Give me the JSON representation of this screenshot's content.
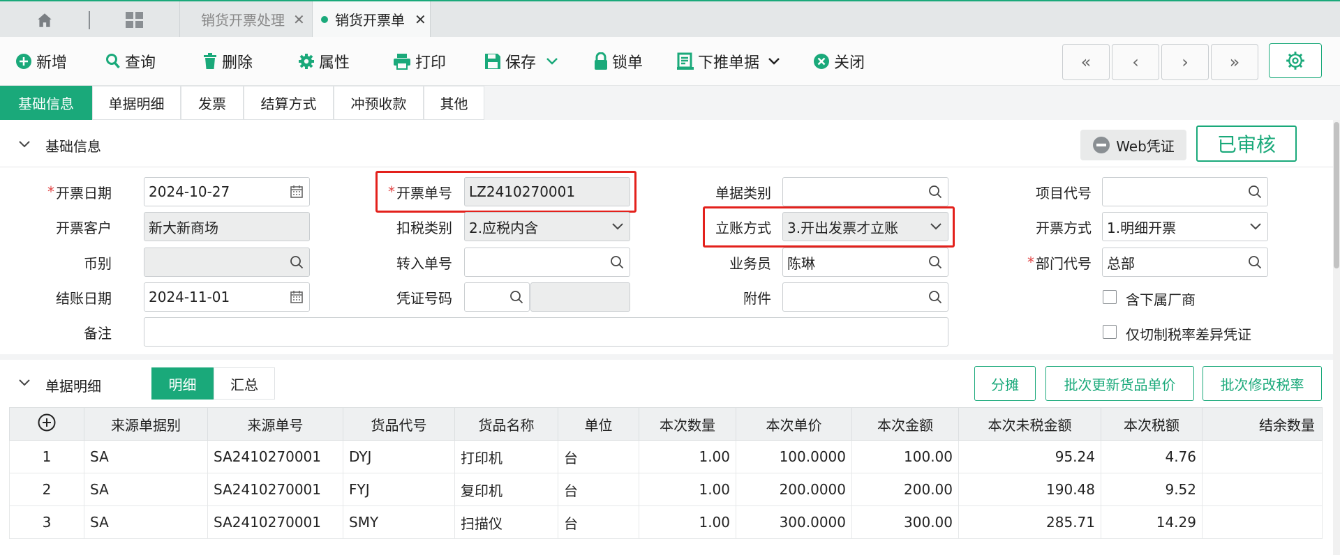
{
  "tabs": {
    "list_tab": "销货开票处理",
    "active_tab": "销货开票单"
  },
  "toolbar": {
    "new": "新增",
    "query": "查询",
    "delete": "删除",
    "properties": "属性",
    "print": "打印",
    "save": "保存",
    "lock": "锁单",
    "push_down": "下推单据",
    "close": "关闭"
  },
  "nav": {
    "first": "«",
    "prev": "‹",
    "next": "›",
    "last": "»"
  },
  "section_tabs": [
    "基础信息",
    "单据明细",
    "发票",
    "结算方式",
    "冲预收款",
    "其他"
  ],
  "basic": {
    "title": "基础信息",
    "web_voucher": "Web凭证",
    "status": "已审核"
  },
  "form": {
    "invoice_date_label": "开票日期",
    "invoice_date": "2024-10-27",
    "invoice_no_label": "开票单号",
    "invoice_no": "LZ2410270001",
    "doc_type_label": "单据类别",
    "doc_type": "",
    "project_code_label": "项目代号",
    "project_code": "",
    "customer_label": "开票客户",
    "customer": "新大新商场",
    "tax_type_label": "扣税类别",
    "tax_type": "2.应税内含",
    "account_method_label": "立账方式",
    "account_method": "3.开出发票才立账",
    "invoice_method_label": "开票方式",
    "invoice_method": "1.明细开票",
    "currency_label": "币别",
    "currency": "",
    "transfer_no_label": "转入单号",
    "transfer_no": "",
    "salesman_label": "业务员",
    "salesman": "陈琳",
    "dept_code_label": "部门代号",
    "dept_code": "总部",
    "close_date_label": "结账日期",
    "close_date": "2024-11-01",
    "voucher_no_label": "凭证号码",
    "attachment_label": "附件",
    "include_sub_label": "含下属厂商",
    "tax_diff_label": "仅切制税率差异凭证",
    "remark_label": "备注",
    "remark": ""
  },
  "detail": {
    "title": "单据明细",
    "seg_detail": "明细",
    "seg_summary": "汇总",
    "btn_allocate": "分摊",
    "btn_batch_price": "批次更新货品单价",
    "btn_batch_tax": "批次修改税率",
    "columns": [
      "来源单据别",
      "来源单号",
      "货品代号",
      "货品名称",
      "单位",
      "本次数量",
      "本次单价",
      "本次金额",
      "本次未税金额",
      "本次税额",
      "结余数量"
    ],
    "rows": [
      [
        "1",
        "SA",
        "SA2410270001",
        "DYJ",
        "打印机",
        "台",
        "1.00",
        "100.0000",
        "100.00",
        "95.24",
        "4.76",
        ""
      ],
      [
        "2",
        "SA",
        "SA2410270001",
        "FYJ",
        "复印机",
        "台",
        "1.00",
        "200.0000",
        "200.00",
        "190.48",
        "9.52",
        ""
      ],
      [
        "3",
        "SA",
        "SA2410270001",
        "SMY",
        "扫描仪",
        "台",
        "1.00",
        "300.0000",
        "300.00",
        "285.71",
        "14.29",
        ""
      ]
    ]
  },
  "colors": {
    "accent": "#1aa97a",
    "highlight": "#e3211c",
    "required": "#e04444"
  }
}
